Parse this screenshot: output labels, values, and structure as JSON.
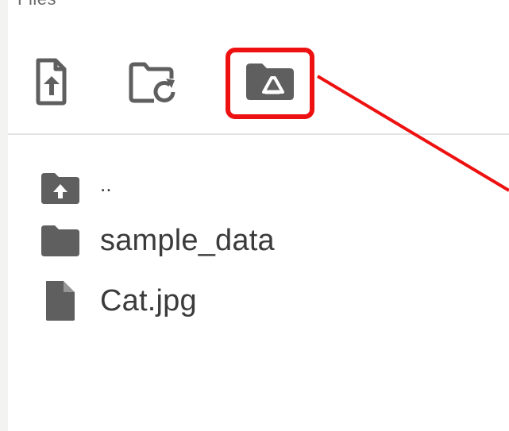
{
  "panel": {
    "cropped_title": "Files"
  },
  "toolbar": {
    "buttons": [
      {
        "name": "upload-file",
        "icon": "upload-file-icon"
      },
      {
        "name": "refresh-folder",
        "icon": "folder-refresh-icon"
      },
      {
        "name": "mount-drive",
        "icon": "google-drive-folder-icon",
        "highlighted": true
      }
    ]
  },
  "file_list": {
    "items": [
      {
        "label": "..",
        "icon": "parent-folder-icon"
      },
      {
        "label": "sample_data",
        "icon": "folder-icon"
      },
      {
        "label": "Cat.jpg",
        "icon": "file-icon"
      }
    ]
  },
  "annotation": {
    "highlight_color": "#ee1111"
  }
}
